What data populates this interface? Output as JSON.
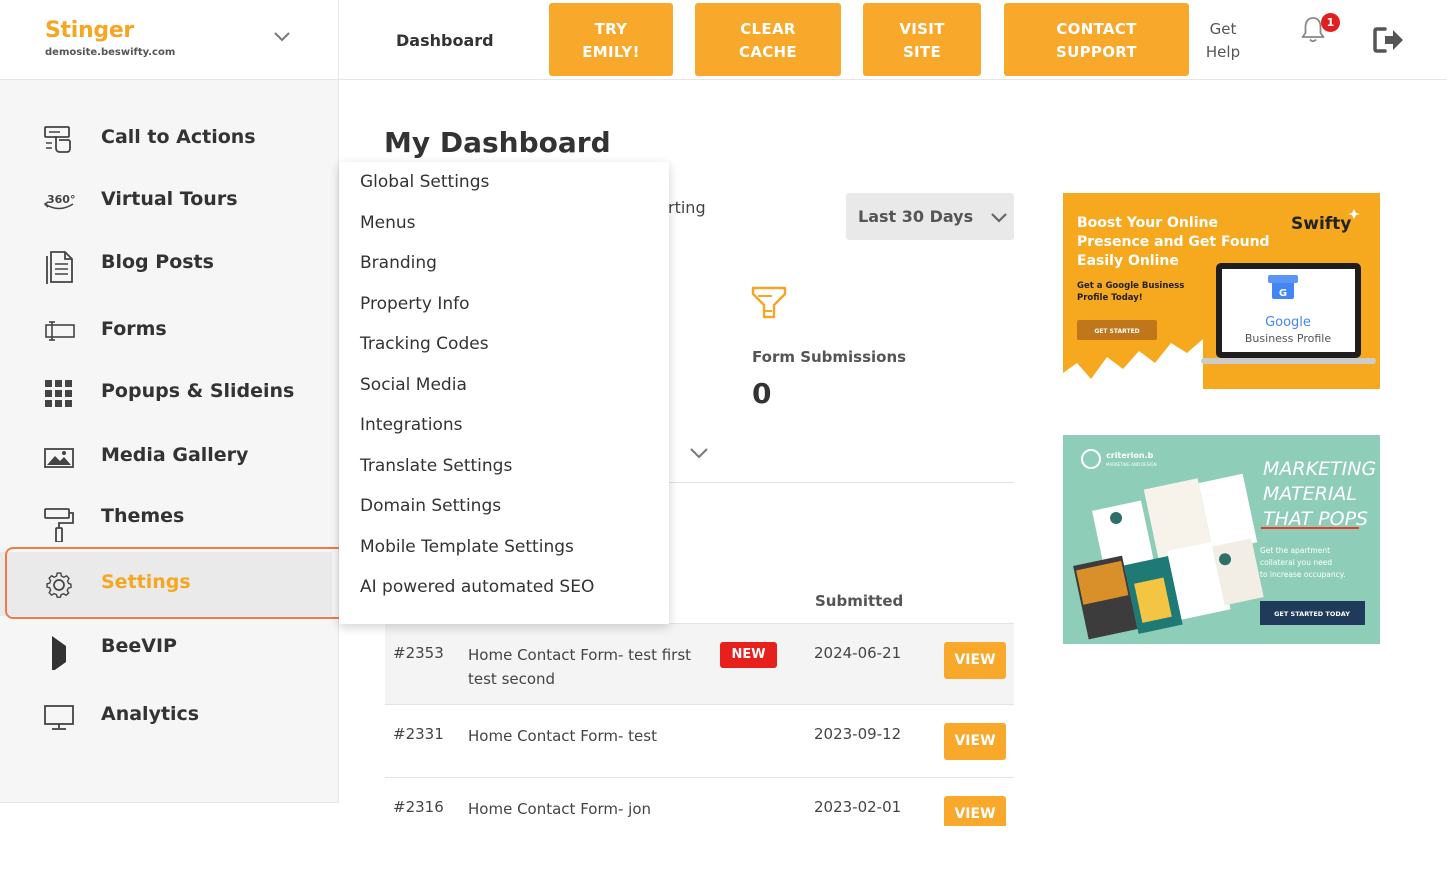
{
  "header": {
    "brand_name": "Stinger",
    "brand_domain": "demosite.beswifty.com",
    "nav_dashboard": "Dashboard",
    "buttons": [
      {
        "line1": "TRY",
        "line2": "EMILY!"
      },
      {
        "line1": "CLEAR",
        "line2": "CACHE"
      },
      {
        "line1": "VISIT",
        "line2": "SITE"
      },
      {
        "line1": "CONTACT",
        "line2": "SUPPORT"
      }
    ],
    "get_help": {
      "line1": "Get",
      "line2": "Help"
    },
    "notification_count": "1",
    "accent_color": "#f8a82a"
  },
  "sidebar": {
    "items": [
      {
        "label": "Call to Actions",
        "icon": "pointer-click-icon"
      },
      {
        "label": "Virtual Tours",
        "icon": "360-icon"
      },
      {
        "label": "Blog Posts",
        "icon": "document-icon"
      },
      {
        "label": "Forms",
        "icon": "text-field-icon"
      },
      {
        "label": "Popups & Slideins",
        "icon": "grid-icon"
      },
      {
        "label": "Media Gallery",
        "icon": "image-icon"
      },
      {
        "label": "Themes",
        "icon": "paint-roller-icon"
      },
      {
        "label": "Settings",
        "icon": "gear-icon",
        "active": true
      },
      {
        "label": "BeeVIP",
        "icon": "bookmark-icon"
      },
      {
        "label": "Analytics",
        "icon": "monitor-icon"
      }
    ]
  },
  "settings_menu": {
    "items": [
      "Global Settings",
      "Menus",
      "Branding",
      "Property Info",
      "Tracking Codes",
      "Social Media",
      "Integrations",
      "Translate Settings",
      "Domain Settings",
      "Mobile Template Settings",
      "AI powered automated SEO"
    ]
  },
  "main": {
    "title": "My Dashboard",
    "partial_text": "rting",
    "date_range": "Last 30 Days",
    "stat": {
      "label": "Form Submissions",
      "value": "0"
    },
    "table": {
      "header_submitted": "Submitted",
      "rows": [
        {
          "id": "#2353",
          "name": "Home Contact Form- test first test second",
          "badge": "NEW",
          "date": "2024-06-21",
          "action": "VIEW"
        },
        {
          "id": "#2331",
          "name": "Home Contact Form- test",
          "badge": "",
          "date": "2023-09-12",
          "action": "VIEW"
        },
        {
          "id": "#2316",
          "name": "Home Contact Form- jon simpson",
          "badge": "",
          "date": "2023-02-01",
          "action": "VIEW"
        }
      ]
    }
  },
  "ads": {
    "ad1": {
      "headline1": "Boost Your Online",
      "headline2": "Presence and Get Found",
      "headline3": "Easily Online",
      "sub1": "Get a Google Business",
      "sub2": "Profile Today!",
      "cta": "GET STARTED",
      "logo": "Swifty",
      "google": "Google",
      "google_sub": "Business Profile"
    },
    "ad2": {
      "brand": "criterion.b",
      "brand_sub": "MARKETING AND DESIGN",
      "headline1": "MARKETING",
      "headline2": "MATERIAL",
      "headline3": "THAT POPS",
      "sub1": "Get the apartment",
      "sub2": "collateral you need",
      "sub3": "to increase occupancy.",
      "cta": "GET STARTED TODAY"
    }
  }
}
